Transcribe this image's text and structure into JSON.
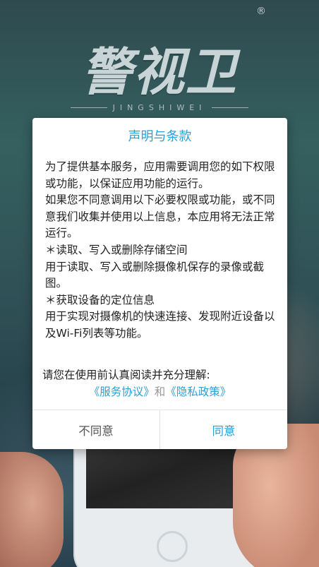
{
  "background": {
    "logo_title": "警视卫",
    "logo_registered": "®",
    "logo_subtitle": "JINGSHIWEI"
  },
  "dialog": {
    "title": "声明与条款",
    "paragraphs": [
      "为了提供基本服务，应用需要调用您的如下权限或功能，以保证应用功能的运行。",
      "如果您不同意调用以下必要权限或功能，或不同意我们收集并使用以上信息，本应用将无法正常运行。",
      "＊读取、写入或删除存储空间",
      "用于读取、写入或删除摄像机保存的录像或截图。",
      "＊获取设备的定位信息",
      "用于实现对摄像机的快速连接、发现附近设备以及Wi-Fi列表等功能。"
    ],
    "prompt": "请您在使用前认真阅读并充分理解:",
    "service_link": "《服务协议》",
    "and_text": "和",
    "privacy_link": "《隐私政策》",
    "decline_label": "不同意",
    "agree_label": "同意"
  },
  "colors": {
    "accent": "#2a9fd8",
    "text": "#222222",
    "muted": "#999999"
  }
}
